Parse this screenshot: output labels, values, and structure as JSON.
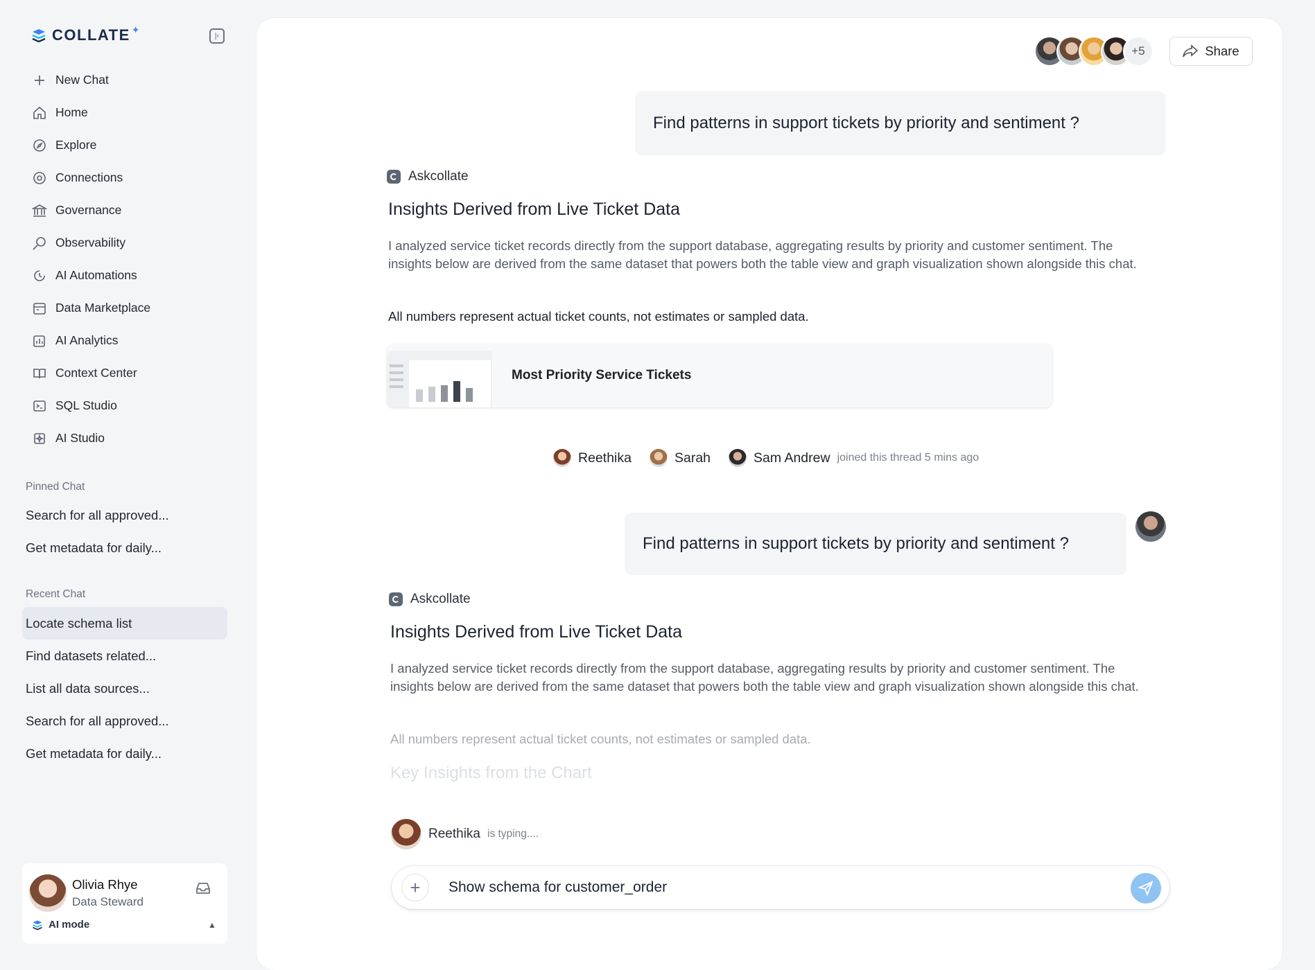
{
  "app": {
    "logo_text": "COLLATE"
  },
  "sidebar": {
    "nav": [
      {
        "label": "New Chat",
        "icon": "plus-icon"
      },
      {
        "label": "Home",
        "icon": "home-icon"
      },
      {
        "label": "Explore",
        "icon": "compass-icon"
      },
      {
        "label": "Connections",
        "icon": "connections-icon"
      },
      {
        "label": "Governance",
        "icon": "bank-icon"
      },
      {
        "label": "Observability",
        "icon": "search-chart-icon"
      },
      {
        "label": "AI Automations",
        "icon": "automation-icon"
      },
      {
        "label": "Data Marketplace",
        "icon": "store-icon"
      },
      {
        "label": "AI Analytics",
        "icon": "analytics-icon"
      },
      {
        "label": "Context Center",
        "icon": "book-icon"
      },
      {
        "label": "SQL Studio",
        "icon": "terminal-icon"
      },
      {
        "label": "AI Studio",
        "icon": "ai-studio-icon"
      }
    ],
    "pinned_title": "Pinned Chat",
    "pinned": [
      "Search for all approved...",
      "Get metadata for daily..."
    ],
    "recent_title": "Recent Chat",
    "recent": [
      "Locate schema list",
      "Find datasets related...",
      "List all data sources...",
      "Search for all approved...",
      "Get metadata for daily..."
    ],
    "active_recent_index": 0,
    "user": {
      "name": "Olivia Rhye",
      "role": "Data Steward",
      "mode_label": "AI mode"
    }
  },
  "header": {
    "extra_collaborators": "+5",
    "share_label": "Share"
  },
  "thread": {
    "question_1": "Find patterns in support tickets by priority and sentiment ?",
    "bot_name": "Askcollate",
    "answer_title": "Insights Derived from Live Ticket Data",
    "answer_body": "I analyzed service ticket records directly from the support database, aggregating results by priority and customer sentiment. The insights below are derived from the same dataset that powers both the table view and graph visualization shown alongside this chat.",
    "answer_note": "All numbers represent actual ticket counts, not estimates or sampled data.",
    "chart_card_title": "Most Priority Service Tickets",
    "joined": {
      "users": [
        "Reethika",
        "Sarah",
        "Sam Andrew"
      ],
      "text": "joined this thread 5 mins ago"
    },
    "question_2": "Find patterns in support tickets by priority and sentiment ?",
    "answer_2_title": "Insights Derived from Live Ticket Data",
    "answer_2_body": "I analyzed service ticket records directly from the support database, aggregating results by priority and customer sentiment. The insights below are derived from the same dataset that powers both the table view and graph visualization shown alongside this chat.",
    "answer_2_note": "All numbers represent actual ticket counts, not estimates or sampled data.",
    "key_insights_title": "Key Insights from the Chart",
    "typing": {
      "name": "Reethika",
      "text": "is typing...."
    }
  },
  "composer": {
    "value": "Show schema for customer_order"
  },
  "colors": {
    "accent": "#3b82f6",
    "send": "#8fc3f2",
    "active_item": "#e6e9f0"
  }
}
